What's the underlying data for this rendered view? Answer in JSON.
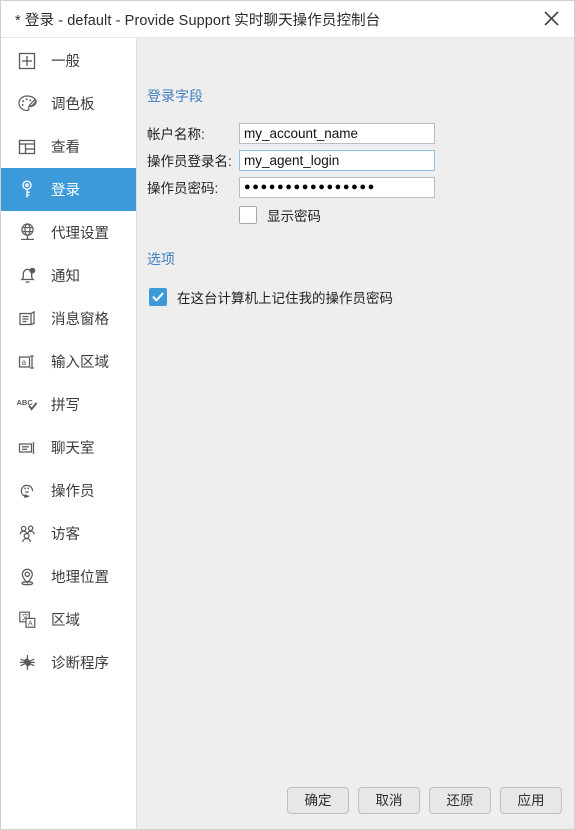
{
  "window": {
    "title": "* 登录 - default - Provide Support 实时聊天操作员控制台",
    "close_icon": "close-icon"
  },
  "colors": {
    "accent": "#3d9ad9",
    "section_heading": "#3f7fbf",
    "pane_bg": "#eeeeee",
    "sidebar_bg": "#ffffff"
  },
  "sidebar": {
    "items": [
      {
        "label": "一般",
        "icon": "plus-box-icon",
        "selected": false
      },
      {
        "label": "调色板",
        "icon": "palette-icon",
        "selected": false
      },
      {
        "label": "查看",
        "icon": "layout-panes-icon",
        "selected": false
      },
      {
        "label": "登录",
        "icon": "key-icon",
        "selected": true
      },
      {
        "label": "代理设置",
        "icon": "globe-network-icon",
        "selected": false
      },
      {
        "label": "通知",
        "icon": "bell-icon",
        "selected": false
      },
      {
        "label": "消息窗格",
        "icon": "message-pane-icon",
        "selected": false
      },
      {
        "label": "输入区域",
        "icon": "text-input-icon",
        "selected": false
      },
      {
        "label": "拼写",
        "icon": "spellcheck-icon",
        "selected": false
      },
      {
        "label": "聊天室",
        "icon": "chat-room-icon",
        "selected": false
      },
      {
        "label": "操作员",
        "icon": "headset-agent-icon",
        "selected": false
      },
      {
        "label": "访客",
        "icon": "visitors-icon",
        "selected": false
      },
      {
        "label": "地理位置",
        "icon": "map-pin-icon",
        "selected": false
      },
      {
        "label": "区域",
        "icon": "translate-icon",
        "selected": false
      },
      {
        "label": "诊断程序",
        "icon": "bug-icon",
        "selected": false
      }
    ]
  },
  "main": {
    "login_fields": {
      "title": "登录字段",
      "account_label": "帐户名称:",
      "account_value": "my_account_name",
      "agent_login_label": "操作员登录名:",
      "agent_login_value": "my_agent_login",
      "password_label": "操作员密码:",
      "password_masked": "●●●●●●●●●●●●●●●●",
      "show_password_label": "显示密码",
      "show_password_checked": false
    },
    "options": {
      "title": "选项",
      "remember_label": "在这台计算机上记住我的操作员密码",
      "remember_checked": true
    }
  },
  "footer": {
    "ok_label": "确定",
    "cancel_label": "取消",
    "restore_label": "还原",
    "apply_label": "应用"
  }
}
